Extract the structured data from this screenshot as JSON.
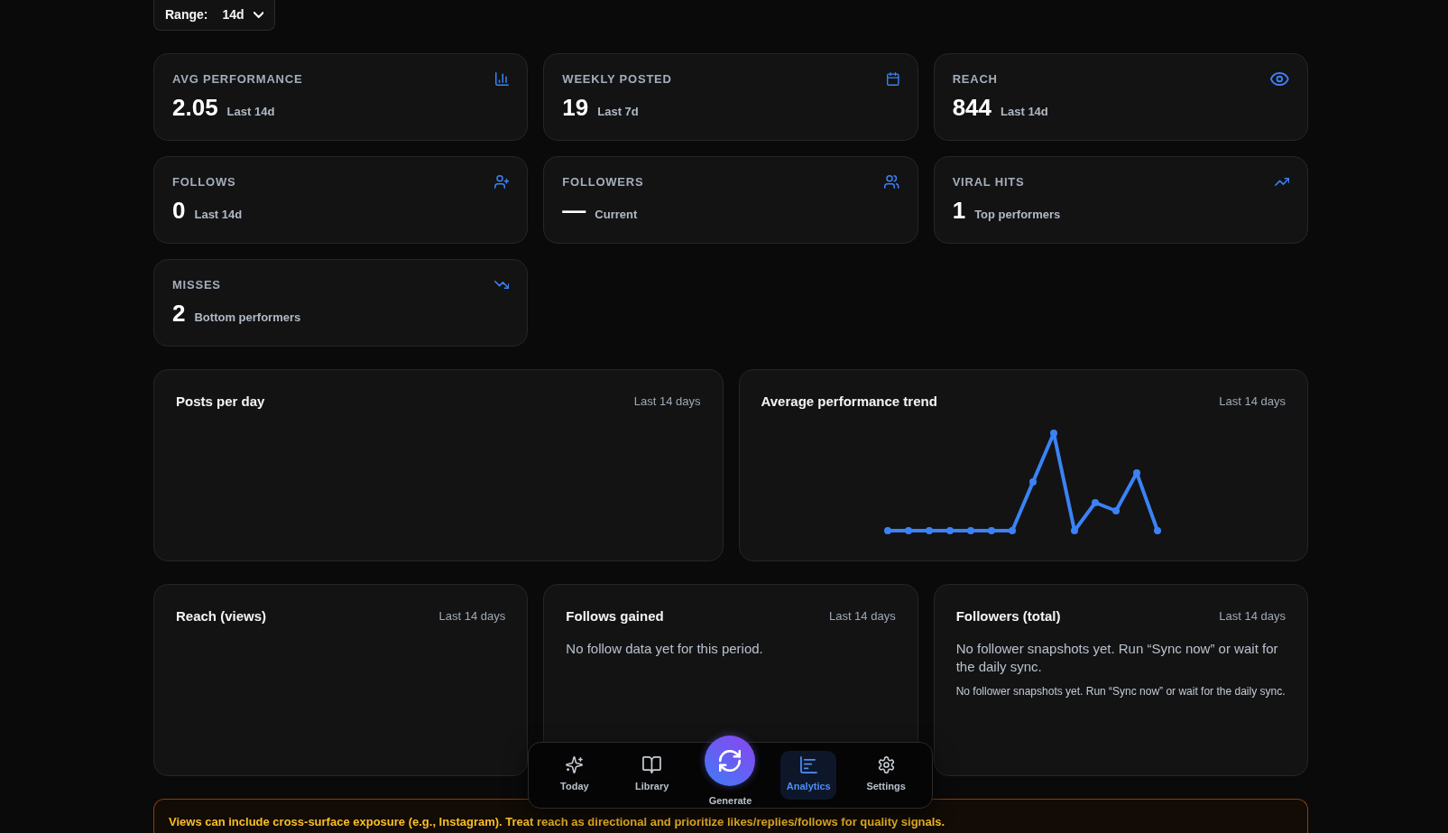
{
  "range": {
    "label": "Range:",
    "value": "14d"
  },
  "stats": [
    {
      "label": "AVG PERFORMANCE",
      "value": "2.05",
      "caption": "Last 14d"
    },
    {
      "label": "WEEKLY POSTED",
      "value": "19",
      "caption": "Last 7d"
    },
    {
      "label": "REACH",
      "value": "844",
      "caption": "Last 14d"
    },
    {
      "label": "FOLLOWS",
      "value": "0",
      "caption": "Last 14d"
    },
    {
      "label": "FOLLOWERS",
      "value": "—",
      "caption": "Current"
    },
    {
      "label": "VIRAL HITS",
      "value": "1",
      "caption": "Top performers"
    },
    {
      "label": "MISSES",
      "value": "2",
      "caption": "Bottom performers"
    }
  ],
  "charts": [
    {
      "kind": "empty",
      "title": "Posts per day",
      "period": "Last 14 days"
    },
    {
      "kind": "line",
      "title": "Average performance trend",
      "period": "Last 14 days"
    }
  ],
  "panels": [
    {
      "title": "Reach (views)",
      "period": "Last 14 days"
    },
    {
      "title": "Follows gained",
      "period": "Last 14 days",
      "message": "No follow data yet for this period."
    },
    {
      "title": "Followers (total)",
      "period": "Last 14 days",
      "message": "No follower snapshots yet. Run “Sync now” or wait for the daily sync.",
      "note": "No follower snapshots yet. Run “Sync now” or wait for the daily sync."
    }
  ],
  "notice": "Views can include cross-surface exposure (e.g., Instagram). Treat reach as directional and prioritize likes/replies/follows for quality signals.",
  "nav": [
    {
      "kind": "tab",
      "label": "Today",
      "selected": false
    },
    {
      "kind": "tab",
      "label": "Library",
      "selected": false
    },
    {
      "kind": "action",
      "label": "Generate",
      "selected": false
    },
    {
      "kind": "tab",
      "label": "Analytics",
      "selected": true
    },
    {
      "kind": "tab",
      "label": "Settings",
      "selected": false
    }
  ]
}
